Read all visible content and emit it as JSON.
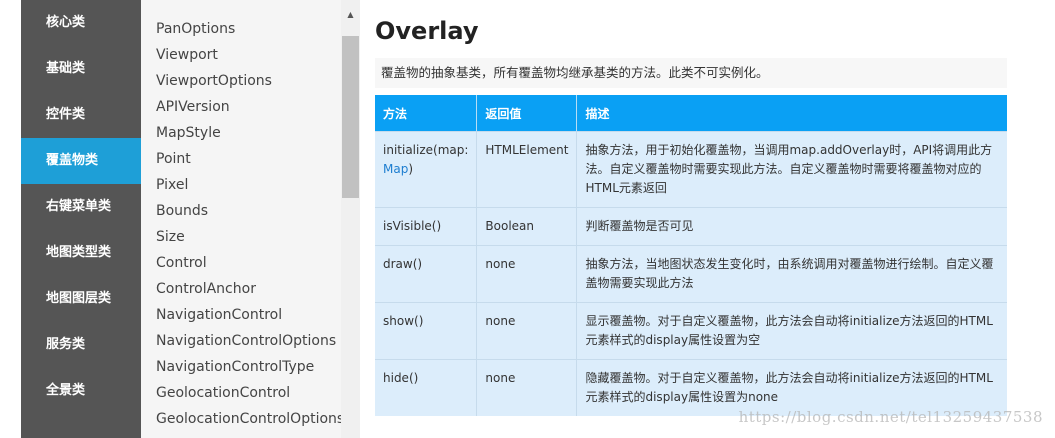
{
  "sidebar": {
    "items": [
      {
        "label": "核心类"
      },
      {
        "label": "基础类"
      },
      {
        "label": "控件类"
      },
      {
        "label": "覆盖物类",
        "active": true
      },
      {
        "label": "右键菜单类"
      },
      {
        "label": "地图类型类"
      },
      {
        "label": "地图图层类"
      },
      {
        "label": "服务类"
      },
      {
        "label": "全景类"
      }
    ]
  },
  "class_list": {
    "items": [
      "PanOptions",
      "Viewport",
      "ViewportOptions",
      "APIVersion",
      "MapStyle",
      "Point",
      "Pixel",
      "Bounds",
      "Size",
      "Control",
      "ControlAnchor",
      "NavigationControl",
      "NavigationControlOptions",
      "NavigationControlType",
      "GeolocationControl",
      "GeolocationControlOptions"
    ]
  },
  "scrollbar": {
    "up_arrow": "▲"
  },
  "main": {
    "title": "Overlay",
    "description": "覆盖物的抽象基类，所有覆盖物均继承基类的方法。此类不可实例化。",
    "table": {
      "headers": [
        "方法",
        "返回值",
        "描述"
      ],
      "rows": [
        {
          "method": "initialize(map:",
          "method_link": "Map",
          "method_suffix": ")",
          "return": "HTMLElement",
          "desc": "抽象方法，用于初始化覆盖物，当调用map.addOverlay时，API将调用此方法。自定义覆盖物时需要实现此方法。自定义覆盖物时需要将覆盖物对应的HTML元素返回"
        },
        {
          "method": "isVisible()",
          "return": "Boolean",
          "desc": "判断覆盖物是否可见"
        },
        {
          "method": "draw()",
          "return": "none",
          "desc": "抽象方法，当地图状态发生变化时，由系统调用对覆盖物进行绘制。自定义覆盖物需要实现此方法"
        },
        {
          "method": "show()",
          "return": "none",
          "desc": "显示覆盖物。对于自定义覆盖物，此方法会自动将initialize方法返回的HTML元素样式的display属性设置为空"
        },
        {
          "method": "hide()",
          "return": "none",
          "desc": "隐藏覆盖物。对于自定义覆盖物，此方法会自动将initialize方法返回的HTML元素样式的display属性设置为none"
        }
      ]
    }
  },
  "watermark": "https://blog.csdn.net/tel13259437538",
  "colors": {
    "sidebar_bg": "#555555",
    "active": "#1e9fd7",
    "table_header": "#0aa0f4",
    "table_cell": "#dcedfb"
  }
}
